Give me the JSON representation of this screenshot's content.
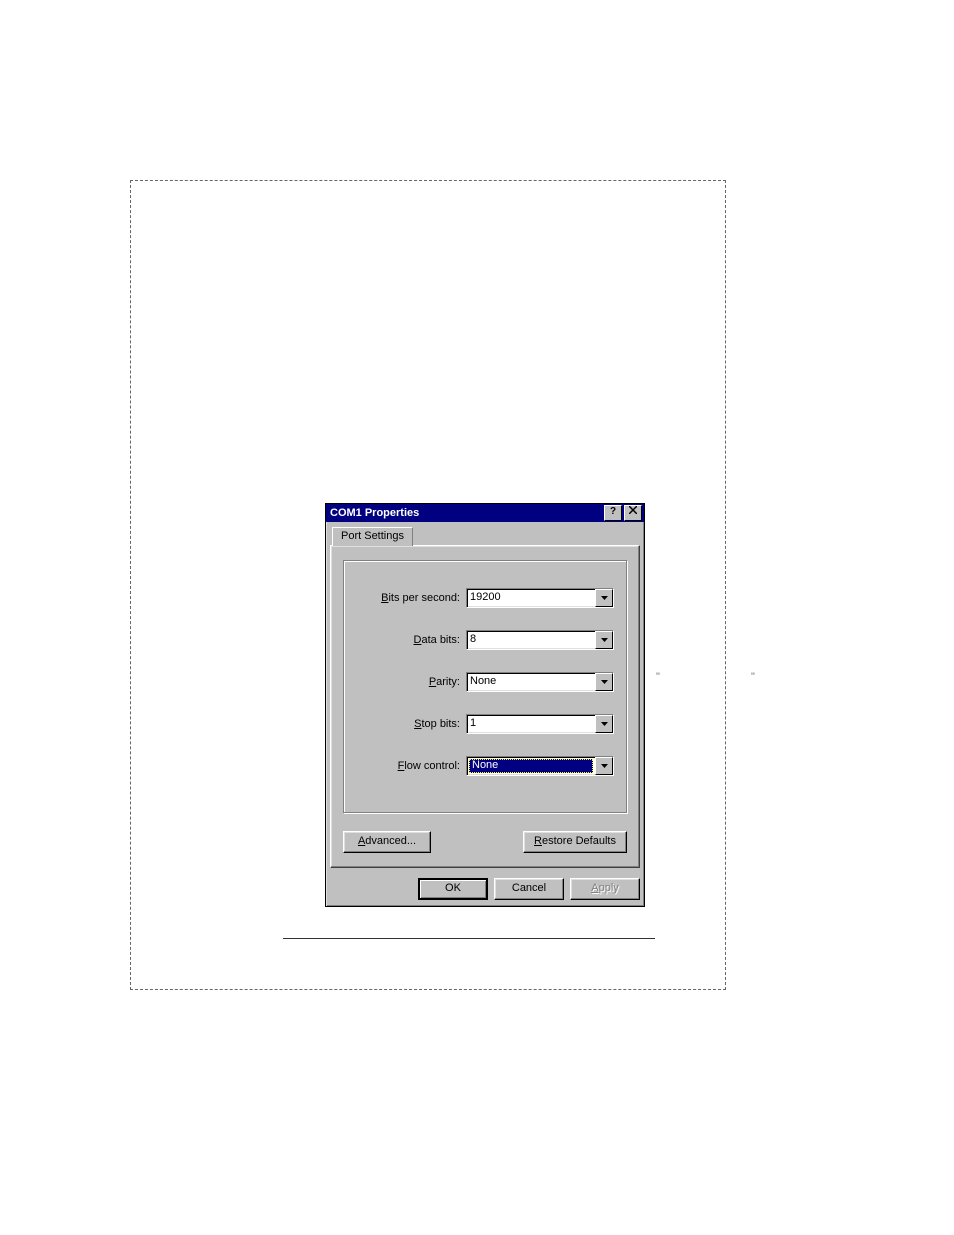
{
  "dialog": {
    "title": "COM1 Properties",
    "tab": "Port Settings",
    "fields": {
      "bits_per_second": {
        "label": "Bits per second:",
        "value": "19200"
      },
      "data_bits": {
        "label": "Data bits:",
        "value": "8"
      },
      "parity": {
        "label": "Parity:",
        "value": "None"
      },
      "stop_bits": {
        "label": "Stop bits:",
        "value": "1"
      },
      "flow_control": {
        "label": "Flow control:",
        "value": "None"
      }
    },
    "buttons": {
      "advanced": "Advanced...",
      "restore": "Restore Defaults",
      "ok": "OK",
      "cancel": "Cancel",
      "apply": "Apply"
    }
  }
}
